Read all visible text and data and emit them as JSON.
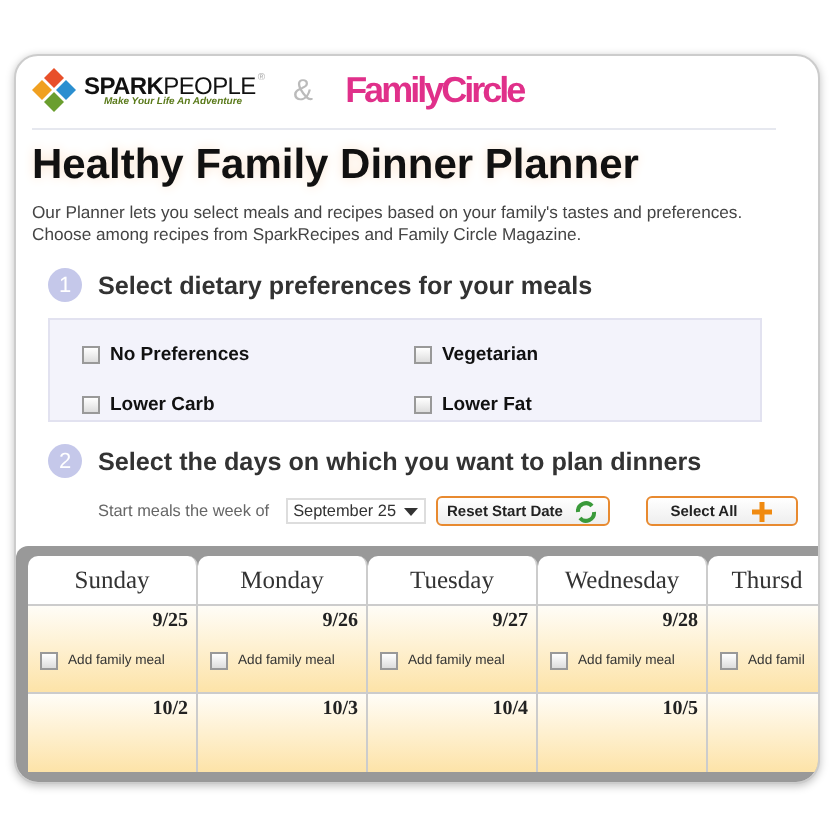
{
  "logos": {
    "brand": "**SPARK**PEOPLE",
    "brand_mark": "®",
    "tagline": "Make Your Life An Adventure",
    "separator": "&",
    "partner": "FamilyCircle"
  },
  "title": "Healthy Family Dinner Planner",
  "intro": "Our Planner lets you select meals and recipes based on your family's tastes and preferences. Choose among recipes from SparkRecipes and Family Circle Magazine.",
  "steps": [
    {
      "number": "1",
      "heading": "Select dietary preferences for your meals"
    },
    {
      "number": "2",
      "heading": "Select the days on which you want to plan dinners"
    }
  ],
  "preferences": [
    {
      "label": "No Preferences",
      "checked": false
    },
    {
      "label": "Vegetarian",
      "checked": false
    },
    {
      "label": "Lower Carb",
      "checked": false
    },
    {
      "label": "Lower Fat",
      "checked": false
    }
  ],
  "week": {
    "label": "Start meals the week of",
    "value": "September 25"
  },
  "buttons": [
    {
      "label": "Reset Start Date",
      "kind": "reset"
    },
    {
      "label": "Select All",
      "kind": "add"
    }
  ],
  "calendar": {
    "days": [
      "Sunday",
      "Monday",
      "Tuesday",
      "Wednesday",
      "Thursd"
    ],
    "rows": [
      [
        {
          "date": "9/25",
          "meal": "Add family meal",
          "checked": false
        },
        {
          "date": "9/26",
          "meal": "Add family meal",
          "checked": false
        },
        {
          "date": "9/27",
          "meal": "Add family meal",
          "checked": false
        },
        {
          "date": "9/28",
          "meal": "Add family meal",
          "checked": false
        },
        {
          "meal": "Add famil",
          "checked": false
        }
      ],
      [
        {
          "date": "10/2"
        },
        {
          "date": "10/3"
        },
        {
          "date": "10/4"
        },
        {
          "date": "10/5"
        },
        {}
      ]
    ]
  }
}
